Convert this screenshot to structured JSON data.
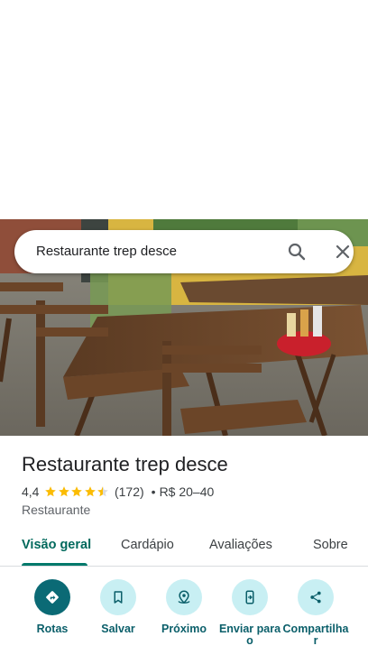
{
  "search": {
    "query": "Restaurante trep desce"
  },
  "place": {
    "name": "Restaurante trep desce",
    "rating": "4,4",
    "stars": 4.5,
    "review_count": "(172)",
    "separator": "•",
    "price": "R$ 20–40",
    "category": "Restaurante"
  },
  "tabs": [
    {
      "label": "Visão geral",
      "active": true
    },
    {
      "label": "Cardápio",
      "active": false
    },
    {
      "label": "Avaliações",
      "active": false
    },
    {
      "label": "Sobre",
      "active": false
    }
  ],
  "actions": [
    {
      "label": "Rotas",
      "icon": "directions-icon"
    },
    {
      "label": "Salvar",
      "icon": "bookmark-icon"
    },
    {
      "label": "Próximo",
      "icon": "nearby-icon"
    },
    {
      "label": "Enviar para o",
      "icon": "send-to-phone-icon"
    },
    {
      "label": "Compartilhar",
      "icon": "share-icon"
    }
  ],
  "colors": {
    "accent": "#00796b",
    "action_bg": "#c8eff3",
    "action_primary": "#0b6a75",
    "star": "#fbbc04"
  }
}
